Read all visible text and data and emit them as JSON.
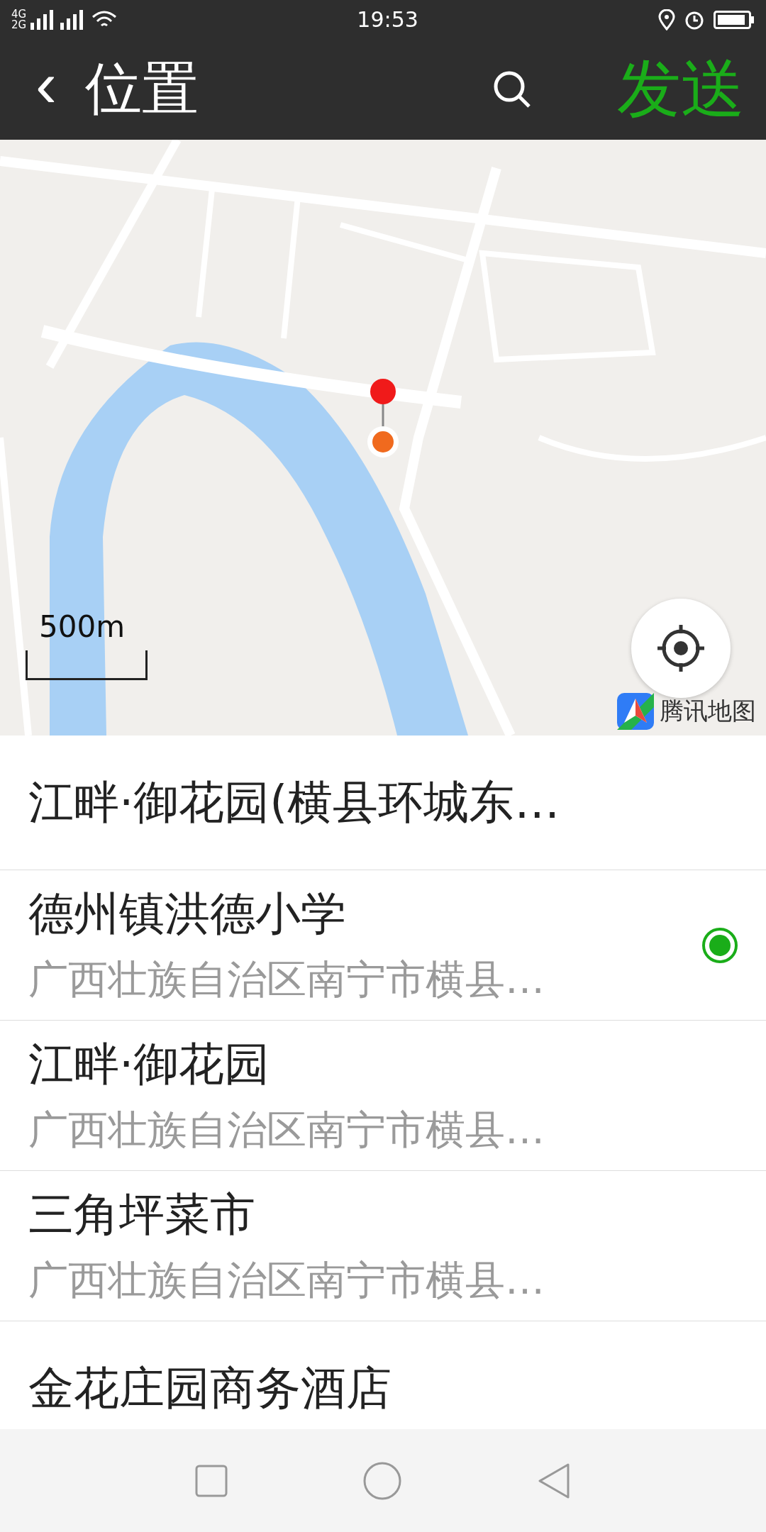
{
  "status_bar": {
    "network_1": "4G",
    "network_2": "2G",
    "time": "19:53"
  },
  "header": {
    "back": "‹",
    "title": "位置",
    "send": "发送"
  },
  "map": {
    "kind": "picture",
    "scale": "500m",
    "logo": "腾讯地图"
  },
  "places": [
    {
      "name": "江畔·御花园(横县环城东…",
      "selected": false
    },
    {
      "name": "德州镇洪德小学",
      "address": "广西壮族自治区南宁市横县…",
      "selected": true
    },
    {
      "name": "江畔·御花园",
      "address": "广西壮族自治区南宁市横县…",
      "selected": false
    },
    {
      "name": "三角坪菜市",
      "address": "广西壮族自治区南宁市横县…",
      "selected": false
    },
    {
      "name": "金花庄园商务酒店",
      "selected": false
    }
  ]
}
